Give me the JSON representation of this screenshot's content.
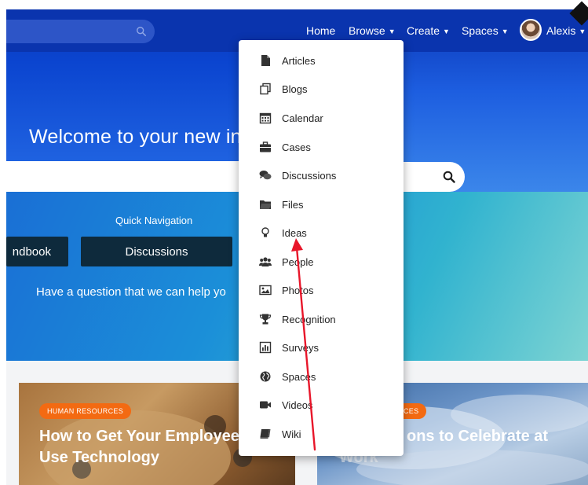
{
  "nav": {
    "home": "Home",
    "browse": "Browse",
    "create": "Create",
    "spaces": "Spaces",
    "user": "Alexis",
    "caret": "▼"
  },
  "hero": {
    "welcome": "Welcome to your new intr"
  },
  "quick_nav": {
    "title": "Quick Navigation",
    "buttons": [
      "ndbook",
      "Discussions"
    ],
    "question": "Have a question that we can help yo"
  },
  "cards": [
    {
      "badge": "HUMAN RESOURCES",
      "title_line1": "How to Get Your Employee",
      "title_line2": "Use Technology"
    },
    {
      "badge": "CES",
      "title_line1": "ons to Celebrate at",
      "title_line2": "Work"
    }
  ],
  "dropdown": {
    "items": [
      {
        "label": "Articles",
        "icon": "file-icon"
      },
      {
        "label": "Blogs",
        "icon": "blogs-icon"
      },
      {
        "label": "Calendar",
        "icon": "calendar-icon"
      },
      {
        "label": "Cases",
        "icon": "briefcase-icon"
      },
      {
        "label": "Discussions",
        "icon": "comments-icon"
      },
      {
        "label": "Files",
        "icon": "folder-icon"
      },
      {
        "label": "Ideas",
        "icon": "lightbulb-icon"
      },
      {
        "label": "People",
        "icon": "users-icon"
      },
      {
        "label": "Photos",
        "icon": "image-icon"
      },
      {
        "label": "Recognition",
        "icon": "trophy-icon"
      },
      {
        "label": "Surveys",
        "icon": "bar-chart-icon"
      },
      {
        "label": "Spaces",
        "icon": "globe-icon"
      },
      {
        "label": "Videos",
        "icon": "video-camera-icon"
      },
      {
        "label": "Wiki",
        "icon": "book-icon"
      }
    ]
  },
  "colors": {
    "navbar": "#0a34ae",
    "badge": "#f36a12",
    "annotation_arrow": "#e8162a",
    "button_dark": "#0e2a3c"
  }
}
